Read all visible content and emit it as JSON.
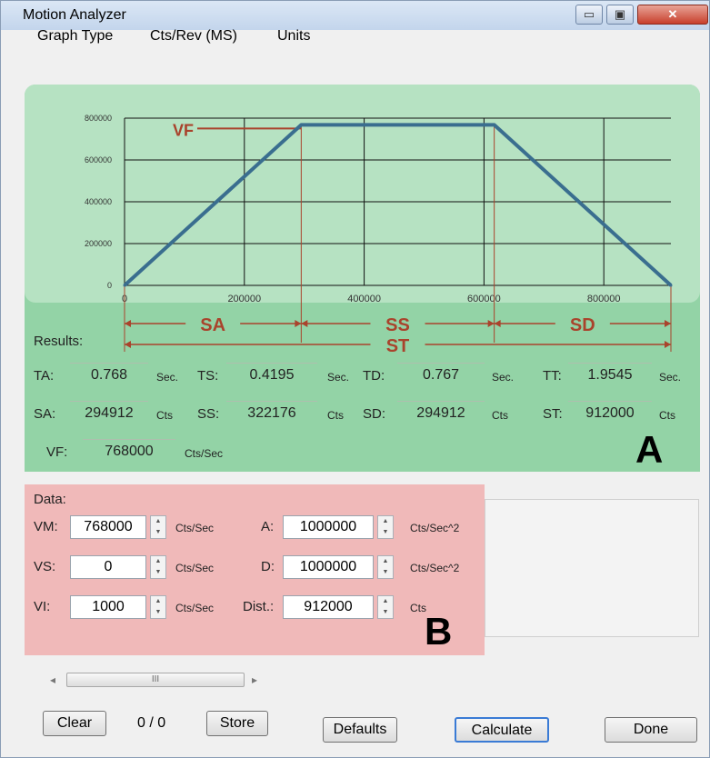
{
  "window": {
    "title": "Motion Analyzer",
    "min_glyph": "▭",
    "max_glyph": "▣",
    "close_glyph": "✕"
  },
  "menu": {
    "items": [
      "Graph Type",
      "Cts/Rev (MS)",
      "Units"
    ]
  },
  "chart_data": {
    "type": "line",
    "x": [
      0,
      294912,
      617088,
      912000
    ],
    "y": [
      0,
      768000,
      768000,
      0
    ],
    "xticks": [
      "0",
      "200000",
      "400000",
      "600000",
      "800000"
    ],
    "yticks": [
      "0",
      "200000",
      "400000",
      "600000",
      "800000"
    ],
    "xlim": [
      0,
      912000
    ],
    "ylim": [
      0,
      800000
    ],
    "grid": true,
    "annotations": [
      "VF",
      "SA",
      "SS",
      "SD",
      "ST"
    ],
    "line_color": "#3a6e8f",
    "annotation_color": "#a9432c"
  },
  "results": {
    "label": "Results:",
    "rows": [
      [
        {
          "name": "TA:",
          "value": "0.768",
          "unit": "Sec."
        },
        {
          "name": "TS:",
          "value": "0.4195",
          "unit": "Sec."
        },
        {
          "name": "TD:",
          "value": "0.767",
          "unit": "Sec."
        },
        {
          "name": "TT:",
          "value": "1.9545",
          "unit": "Sec."
        }
      ],
      [
        {
          "name": "SA:",
          "value": "294912",
          "unit": "Cts"
        },
        {
          "name": "SS:",
          "value": "322176",
          "unit": "Cts"
        },
        {
          "name": "SD:",
          "value": "294912",
          "unit": "Cts"
        },
        {
          "name": "ST:",
          "value": "912000",
          "unit": "Cts"
        }
      ],
      [
        {
          "name": "VF:",
          "value": "768000",
          "unit": "Cts/Sec"
        }
      ]
    ]
  },
  "panel_a_letter": "A",
  "data": {
    "label": "Data:",
    "left": [
      {
        "name": "VM:",
        "value": "768000",
        "unit": "Cts/Sec"
      },
      {
        "name": "VS:",
        "value": "0",
        "unit": "Cts/Sec"
      },
      {
        "name": "VI:",
        "value": "1000",
        "unit": "Cts/Sec"
      }
    ],
    "right": [
      {
        "name": "A:",
        "value": "1000000",
        "unit": "Cts/Sec^2"
      },
      {
        "name": "D:",
        "value": "1000000",
        "unit": "Cts/Sec^2"
      },
      {
        "name": "Dist.:",
        "value": "912000",
        "unit": "Cts"
      }
    ]
  },
  "panel_b_letter": "B",
  "scroll": {
    "left_arrow": "◂",
    "thumb_grip": "III",
    "right_arrow": "▸"
  },
  "buttons": {
    "clear": "Clear",
    "counter": "0 / 0",
    "store": "Store",
    "defaults": "Defaults",
    "calculate": "Calculate",
    "done": "Done"
  },
  "colors": {
    "panel_a": "#93d3a6",
    "panel_b": "#f0b9b9"
  }
}
